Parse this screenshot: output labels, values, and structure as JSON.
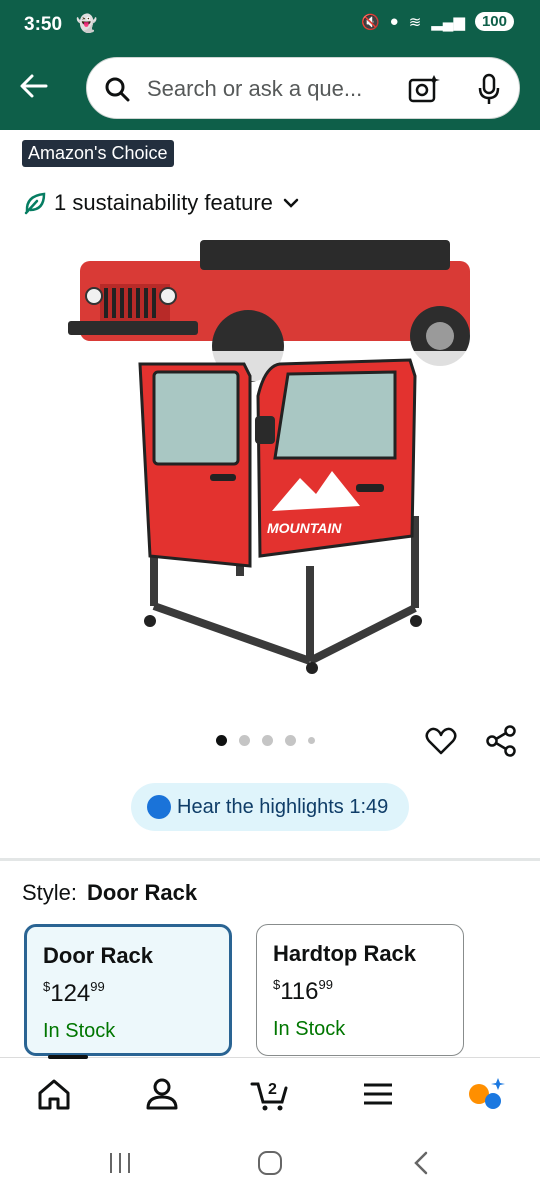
{
  "status": {
    "time": "3:50",
    "battery": "100"
  },
  "search": {
    "placeholder": "Search or ask a que..."
  },
  "badge": {
    "label": "Amazon's Choice"
  },
  "sustainability": {
    "label": "1 sustainability feature"
  },
  "product_image": {
    "brand_text": "MOUNTAIN"
  },
  "carousel": {
    "count": 5,
    "active": 0
  },
  "audio": {
    "label": "Hear the highlights 1:49"
  },
  "style": {
    "label": "Style:",
    "value": "Door Rack"
  },
  "options": [
    {
      "name": "Door Rack",
      "dollar": "$",
      "price": "124",
      "cents": "99",
      "stock": "In Stock",
      "selected": true
    },
    {
      "name": "Hardtop Rack",
      "dollar": "$",
      "price": "116",
      "cents": "99",
      "stock": "In Stock",
      "selected": false
    }
  ],
  "cart": {
    "count": "2"
  },
  "colors": {
    "header": "#0e5f49",
    "instock": "#007600",
    "selected_border": "#2a6493"
  },
  "icons": [
    "back-arrow-icon",
    "search-icon",
    "camera-icon",
    "mic-icon",
    "leaf-icon",
    "chevron-down-icon",
    "heart-icon",
    "share-icon",
    "speaker-icon",
    "home-icon",
    "account-icon",
    "cart-icon",
    "menu-icon",
    "rufus-icon"
  ]
}
